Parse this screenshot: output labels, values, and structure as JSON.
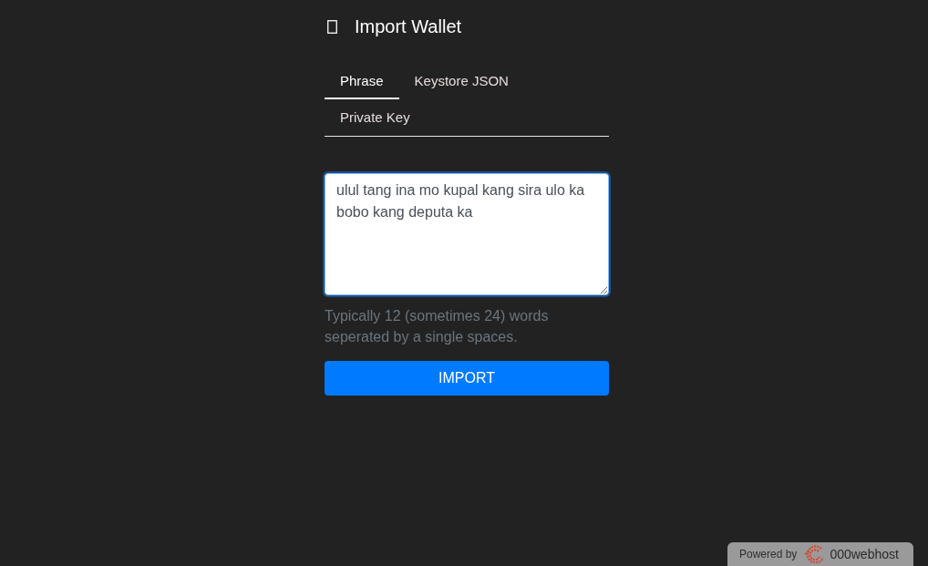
{
  "header": {
    "title": "Import Wallet"
  },
  "tabs": [
    {
      "label": "Phrase",
      "selected": true
    },
    {
      "label": "Keystore JSON",
      "selected": false
    },
    {
      "label": "Private Key",
      "selected": false
    }
  ],
  "phrase_field": {
    "value": "ulul tang ina mo kupal kang sira ulo ka bobo kang deputa ka",
    "focused": true
  },
  "help_text": "Typically 12 (sometimes 24) words seperated by a single spaces.",
  "import_button": {
    "label": "IMPORT"
  },
  "hosting_badge": {
    "prefix": "Powered by",
    "brand": "000webhost"
  }
}
